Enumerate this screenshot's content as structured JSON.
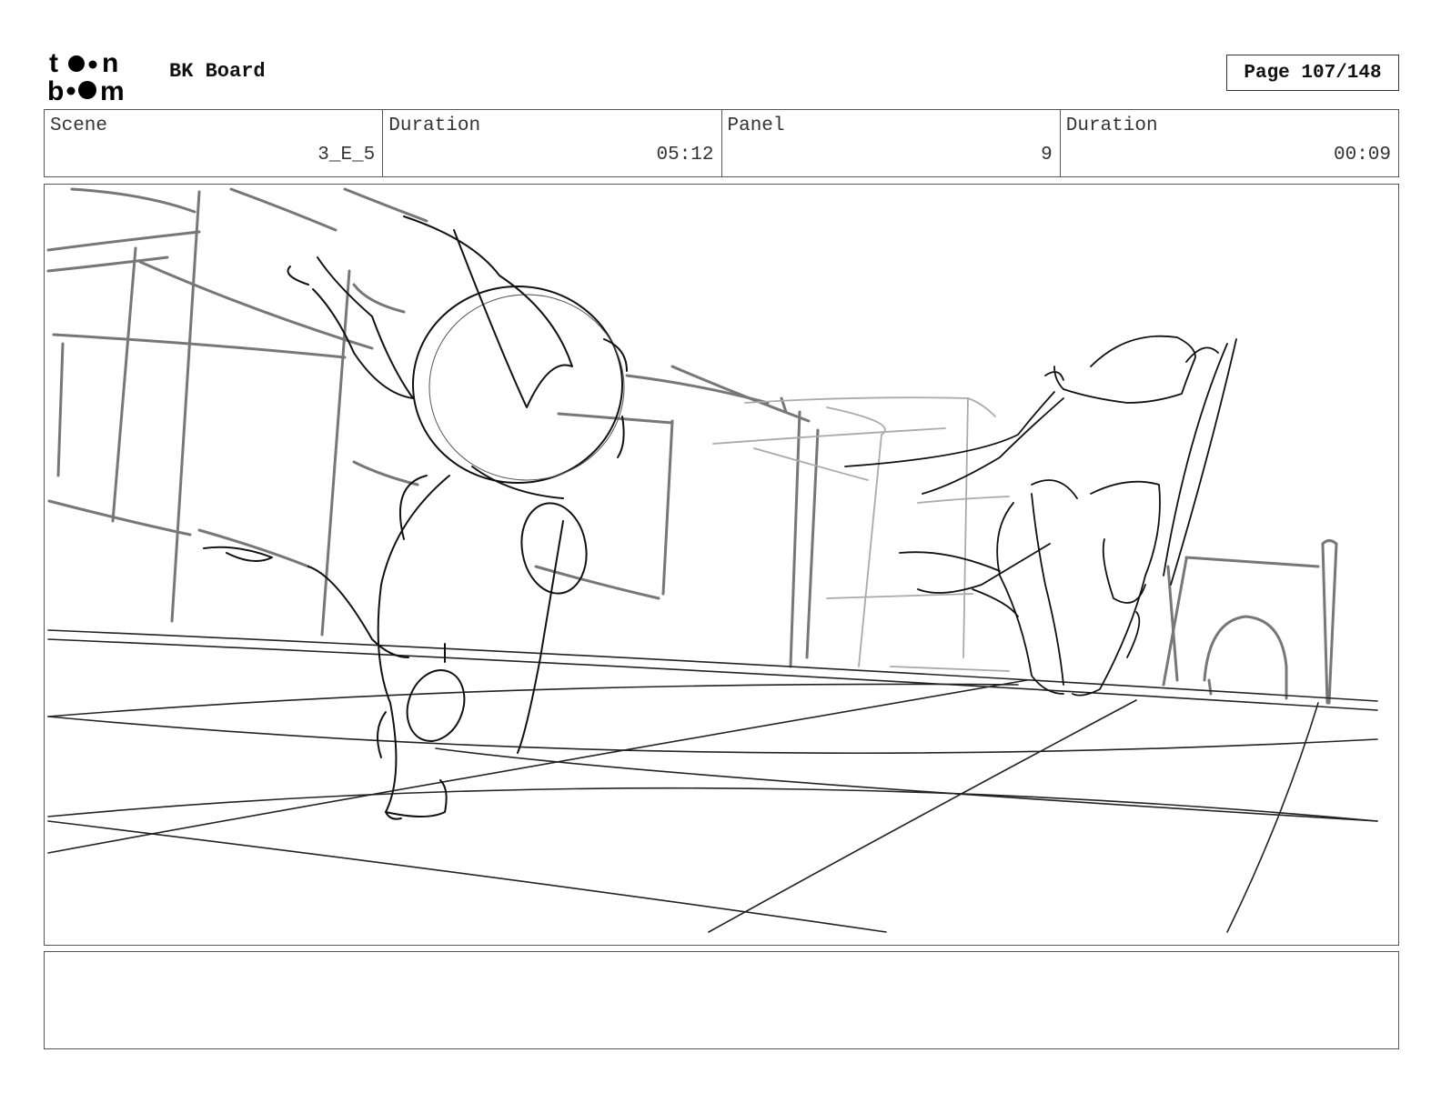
{
  "header": {
    "logo_text": "toon boom",
    "doc_title": "BK Board",
    "page_label": "Page 107/148"
  },
  "info": {
    "scene_label": "Scene",
    "scene_value": "3_E_5",
    "scene_duration_label": "Duration",
    "scene_duration_value": "05:12",
    "panel_label": "Panel",
    "panel_value": "9",
    "panel_duration_label": "Duration",
    "panel_duration_value": "00:09"
  },
  "notes": {
    "text": ""
  }
}
